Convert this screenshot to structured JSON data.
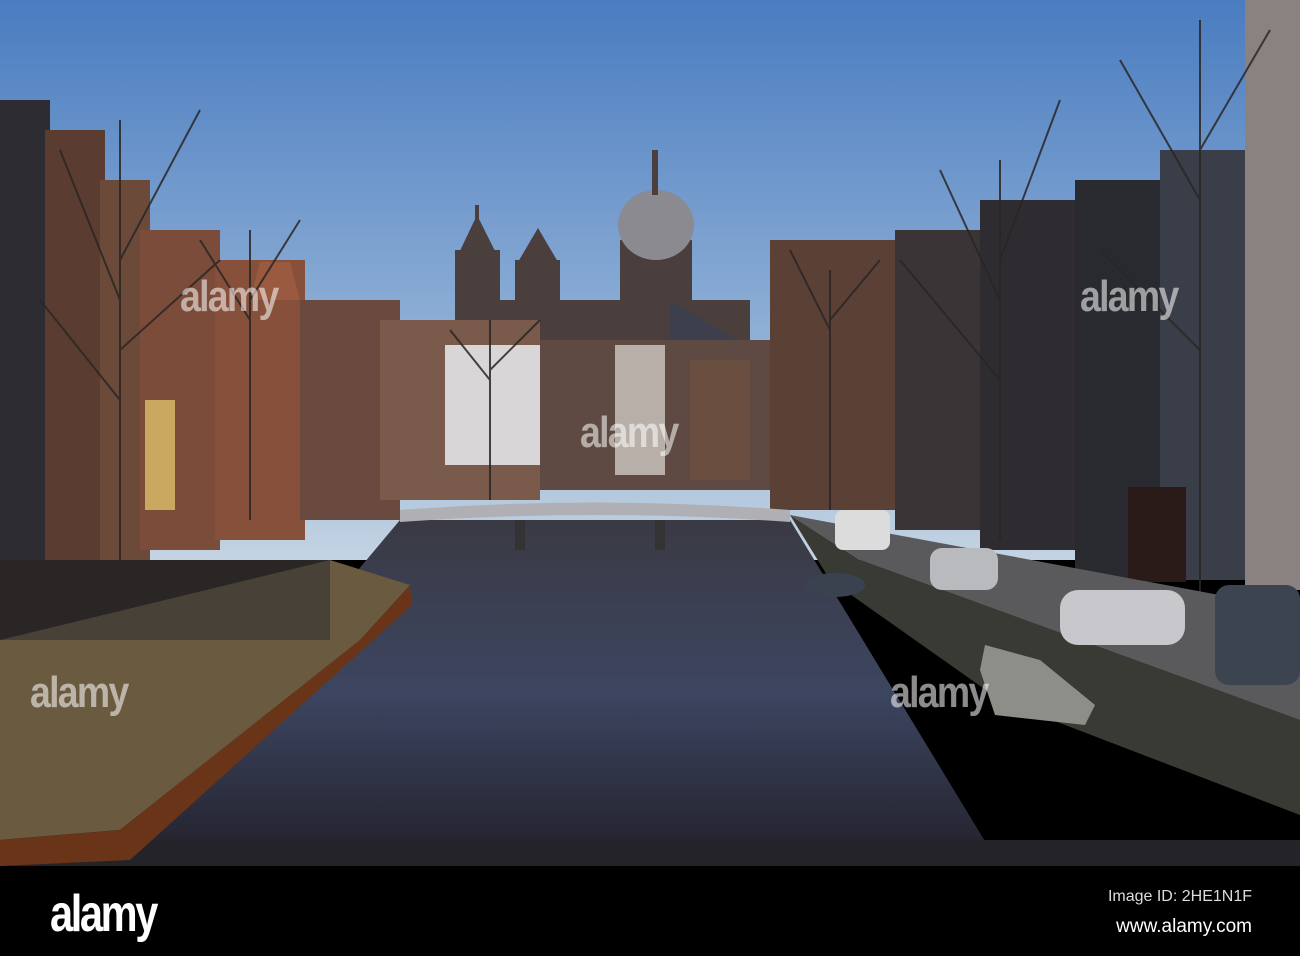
{
  "watermark": {
    "text": "alamy"
  },
  "banner": {
    "logo": "alamy",
    "image_id": "Image ID: 2HE1N1F",
    "website": "www.alamy.com"
  },
  "colors": {
    "sky_top": "#4a7cc0",
    "sky_bottom": "#c3d3e2",
    "water": "#2a2a36",
    "banner": "#000000"
  }
}
